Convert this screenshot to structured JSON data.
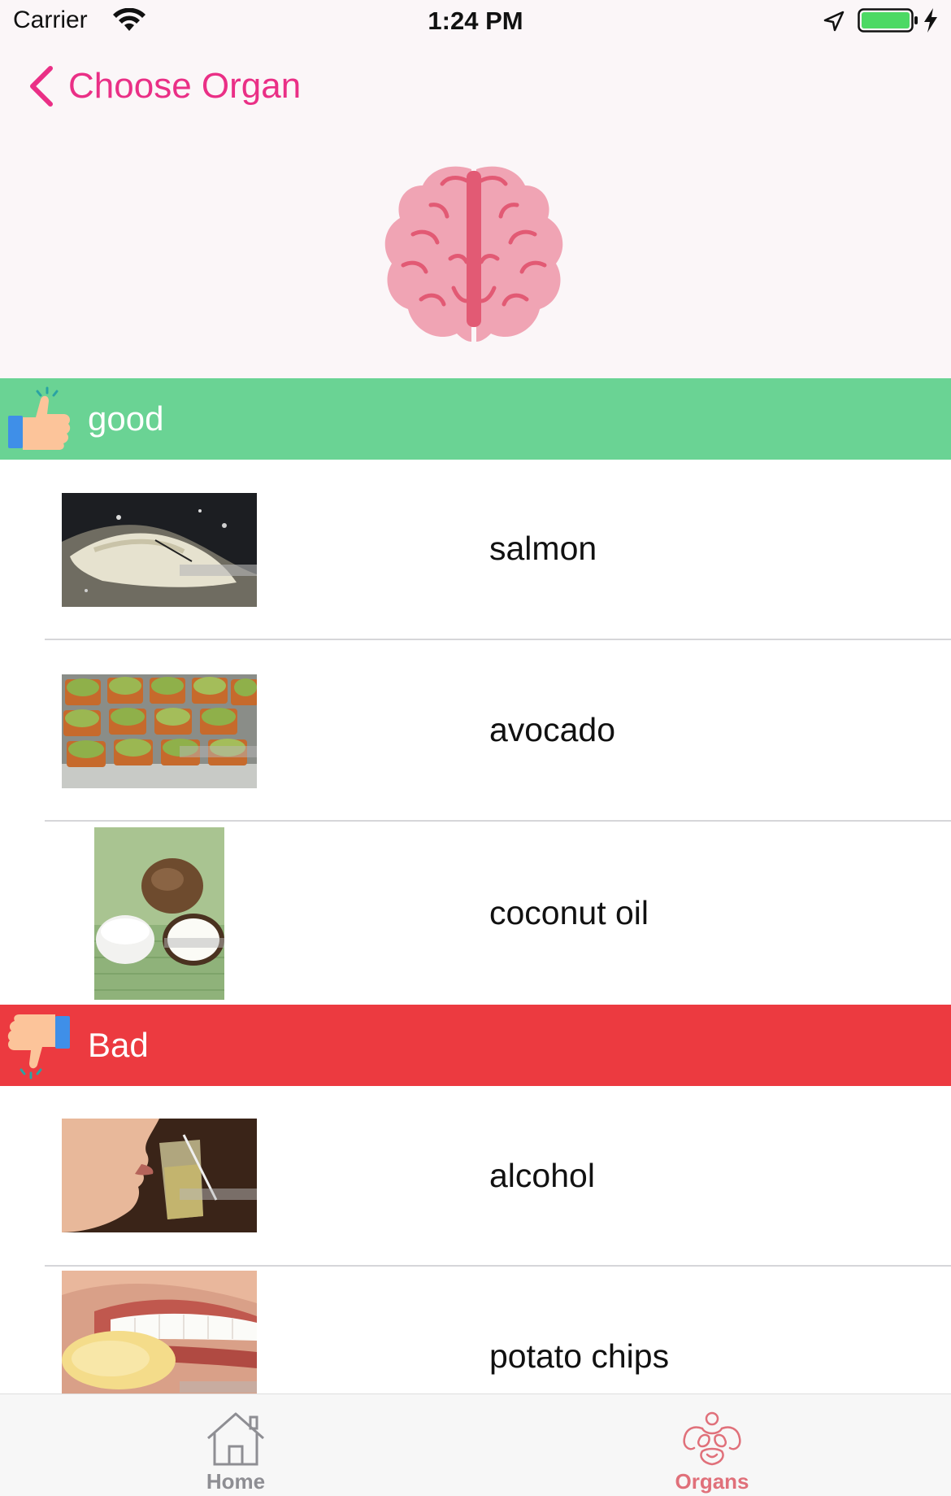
{
  "status_bar": {
    "carrier": "Carrier",
    "time": "1:24 PM",
    "icons": [
      "wifi-icon",
      "location-arrow-icon",
      "battery-icon",
      "charging-bolt-icon"
    ]
  },
  "nav": {
    "back_label": "Choose Organ",
    "back_icon": "chevron-left-icon",
    "organ_icon": "brain-icon"
  },
  "sections": {
    "good": {
      "label": "good",
      "icon": "thumbs-up-icon",
      "color": "#6ad394",
      "items": [
        {
          "label": "salmon",
          "image": "salmon-photo"
        },
        {
          "label": "avocado",
          "image": "avocado-toast-photo"
        },
        {
          "label": "coconut oil",
          "image": "coconut-oil-photo"
        }
      ]
    },
    "bad": {
      "label": "Bad",
      "icon": "thumbs-down-icon",
      "color": "#ec3a40",
      "items": [
        {
          "label": "alcohol",
          "image": "alcohol-photo"
        },
        {
          "label": "potato chips",
          "image": "potato-chips-photo"
        }
      ]
    }
  },
  "tab_bar": {
    "tabs": [
      {
        "label": "Home",
        "icon": "house-icon",
        "selected": false
      },
      {
        "label": "Organs",
        "icon": "organs-body-icon",
        "selected": true
      }
    ]
  },
  "colors": {
    "accent": "#ea2f86",
    "header_bg": "#fbf6f8",
    "brain": "#f0a4b4",
    "brain_lines": "#e25a74",
    "tab_selected": "#e0707a",
    "tab_unselected": "#8e8e93"
  }
}
